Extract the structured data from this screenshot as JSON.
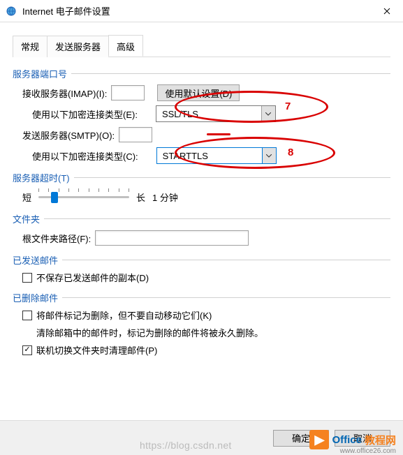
{
  "window": {
    "title": "Internet 电子邮件设置"
  },
  "tabs": {
    "general": "常规",
    "outgoing": "发送服务器",
    "advanced": "高级"
  },
  "ports": {
    "group": "服务器端口号",
    "imap_label": "接收服务器(IMAP)(I):",
    "imap_value": "",
    "defaults_btn": "使用默认设置(D)",
    "enc_label_e": "使用以下加密连接类型(E):",
    "enc_value_e": "SSL/TLS",
    "smtp_label": "发送服务器(SMTP)(O):",
    "smtp_value": "",
    "enc_label_c": "使用以下加密连接类型(C):",
    "enc_value_c": "STARTTLS"
  },
  "timeout": {
    "group": "服务器超时(T)",
    "short": "短",
    "long": "长",
    "value": "1 分钟"
  },
  "folders": {
    "group": "文件夹",
    "root_label": "根文件夹路径(F):",
    "root_value": ""
  },
  "sent": {
    "group": "已发送邮件",
    "nosave": "不保存已发送邮件的副本(D)"
  },
  "deleted": {
    "group": "已删除邮件",
    "mark": "将邮件标记为删除，但不要自动移动它们(K)",
    "note": "清除邮箱中的邮件时，标记为删除的邮件将被永久删除。",
    "purge": "联机切换文件夹时清理邮件(P)"
  },
  "buttons": {
    "ok": "确定",
    "cancel": "取消"
  },
  "annotations": {
    "n7": "7",
    "n8": "8"
  },
  "watermark": "https://blog.csdn.net",
  "logo": {
    "t1": "Office",
    "t2": "教程网",
    "sub": "www.office26.com"
  }
}
